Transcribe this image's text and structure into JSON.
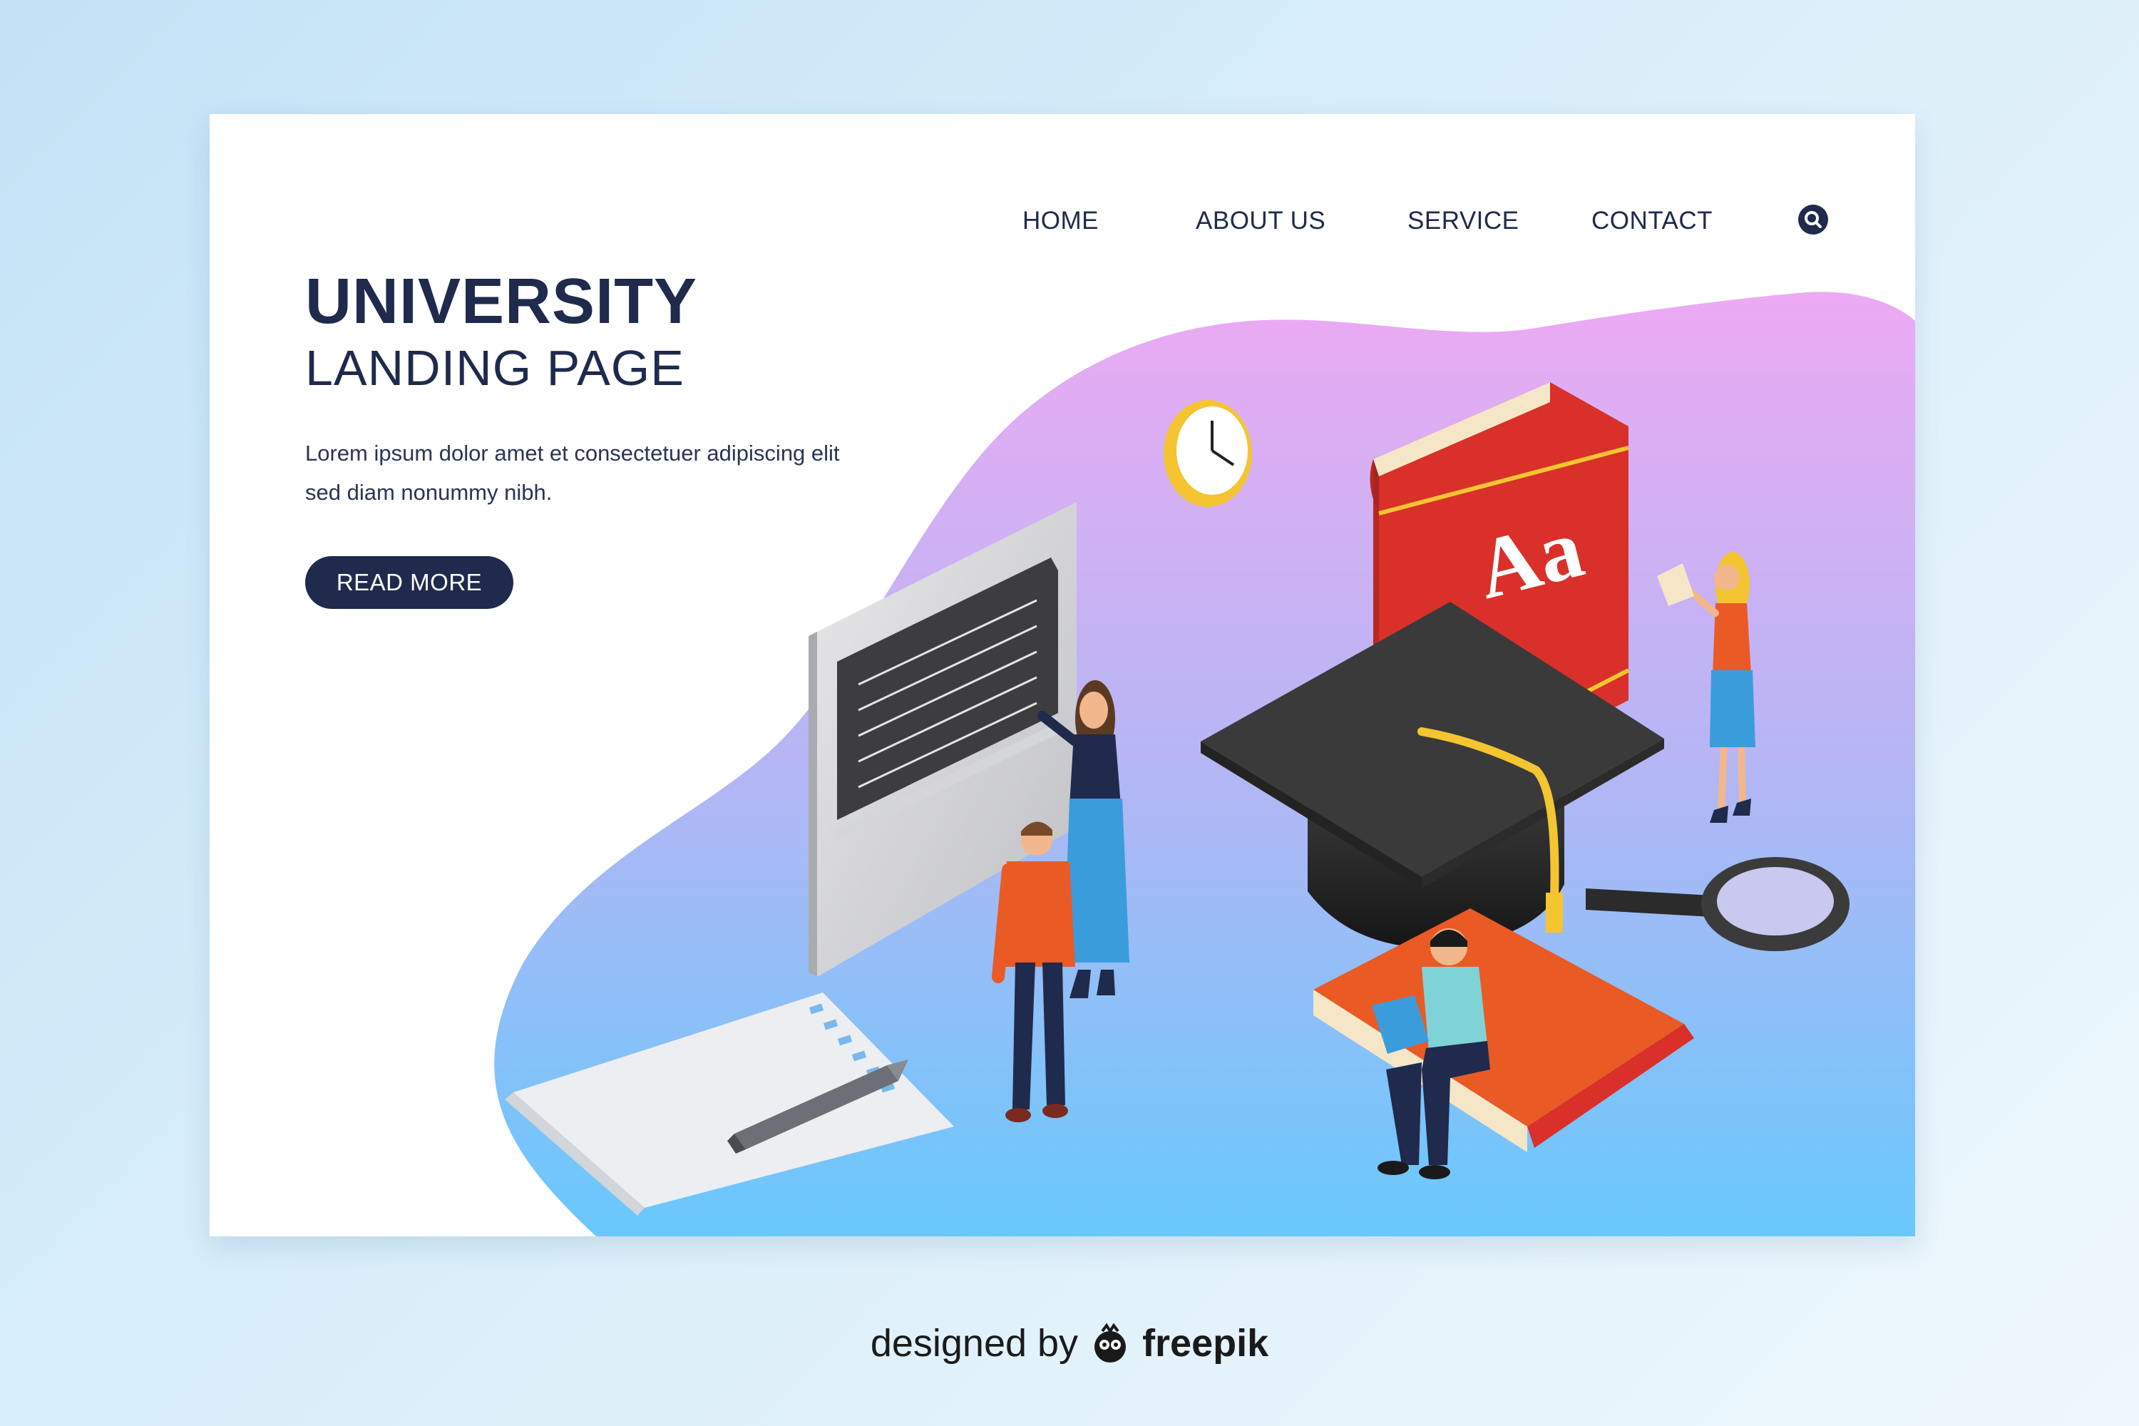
{
  "nav": {
    "items": [
      {
        "label": "HOME"
      },
      {
        "label": "ABOUT US"
      },
      {
        "label": "SERVICE"
      },
      {
        "label": "CONTACT"
      }
    ],
    "search_icon": "search-icon"
  },
  "hero": {
    "title": "UNIVERSITY",
    "subtitle": "LANDING PAGE",
    "description": "Lorem ipsum dolor amet et consectetuer adipiscing elit sed diam nonummy nibh.",
    "button_label": "READ MORE"
  },
  "illustration": {
    "book_letters": "Aa",
    "objects": [
      "whiteboard",
      "graduation-cap",
      "red-book",
      "orange-book",
      "clock",
      "magnifying-glass",
      "paper",
      "pen"
    ],
    "figures": [
      "teacher",
      "student-orange",
      "student-reading",
      "student-holding-phone"
    ]
  },
  "credit": {
    "prefix": "designed by",
    "brand": "freepik"
  },
  "colors": {
    "navy": "#1f2a4c",
    "blob_top": "#e7a6f0",
    "blob_bottom": "#6ac6fb",
    "book_red": "#d9302a",
    "book_orange": "#ea5a25",
    "cap": "#333333",
    "tassel": "#f4c531"
  }
}
